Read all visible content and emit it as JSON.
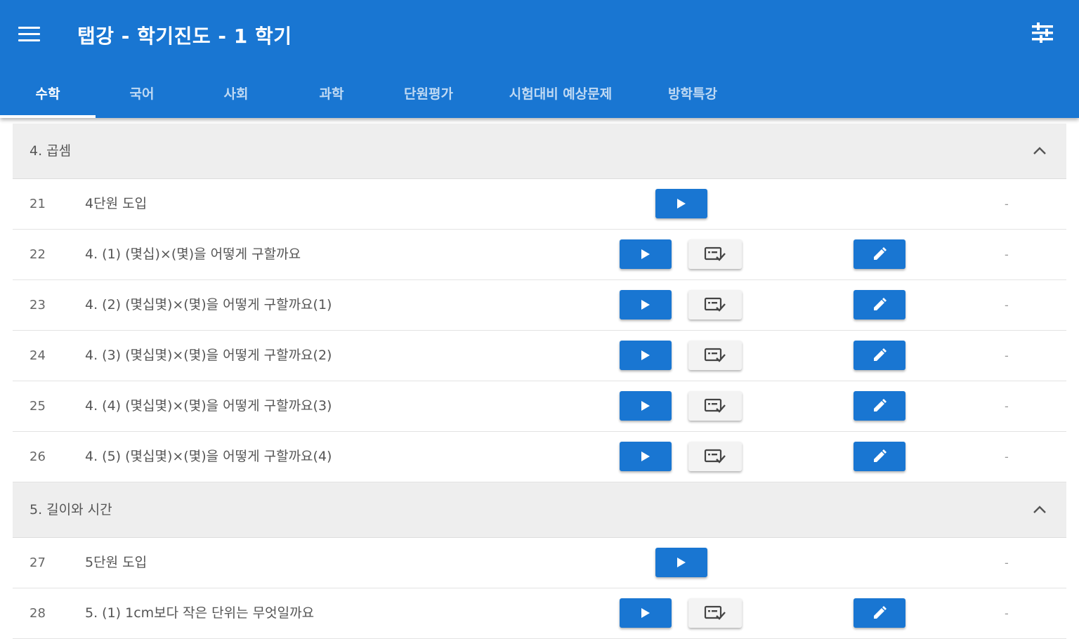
{
  "app": {
    "title": "탭강 - 학기진도 - 1 학기"
  },
  "tabs": [
    {
      "label": "수학"
    },
    {
      "label": "국어"
    },
    {
      "label": "사회"
    },
    {
      "label": "과학"
    },
    {
      "label": "단원평가"
    },
    {
      "label": "시험대비 예상문제"
    },
    {
      "label": "방학특강"
    }
  ],
  "sections": [
    {
      "title": "4. 곱셈",
      "rows": [
        {
          "num": "21",
          "title": "4단원 도입",
          "status": "-"
        },
        {
          "num": "22",
          "title": "4. (1) (몇십)×(몇)을 어떻게 구할까요",
          "status": "-"
        },
        {
          "num": "23",
          "title": "4. (2) (몇십몇)×(몇)을 어떻게 구할까요(1)",
          "status": "-"
        },
        {
          "num": "24",
          "title": "4. (3) (몇십몇)×(몇)을 어떻게 구할까요(2)",
          "status": "-"
        },
        {
          "num": "25",
          "title": "4. (4) (몇십몇)×(몇)을 어떻게 구할까요(3)",
          "status": "-"
        },
        {
          "num": "26",
          "title": "4. (5) (몇십몇)×(몇)을 어떻게 구할까요(4)",
          "status": "-"
        }
      ]
    },
    {
      "title": "5. 길이와 시간",
      "rows": [
        {
          "num": "27",
          "title": "5단원 도입",
          "status": "-"
        },
        {
          "num": "28",
          "title": "5. (1) 1cm보다 작은 단위는 무엇일까요",
          "status": "-"
        }
      ]
    }
  ],
  "colors": {
    "primary": "#1976d2",
    "section_bg": "#eeeeee",
    "check_bg": "#f3f3f3"
  },
  "icons": {
    "menu": "menu-icon",
    "tune": "tune-icon",
    "chevron": "chevron-up-icon",
    "play": "play-icon",
    "check": "check-list-icon",
    "edit": "pencil-icon"
  }
}
